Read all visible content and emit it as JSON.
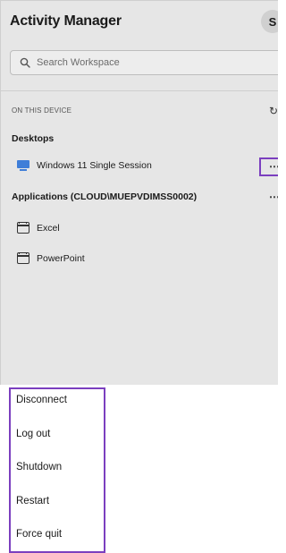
{
  "header": {
    "title": "Activity Manager",
    "avatar_initial": "S"
  },
  "search": {
    "placeholder": "Search Workspace"
  },
  "section": {
    "label": "ON THIS DEVICE"
  },
  "desktops": {
    "heading": "Desktops",
    "items": [
      {
        "label": "Windows 11 Single Session",
        "icon": "monitor-icon"
      }
    ]
  },
  "applications": {
    "heading": "Applications (CLOUD\\MUEPVDIMSS0002)",
    "items": [
      {
        "label": "Excel",
        "icon": "app-window-icon"
      },
      {
        "label": "PowerPoint",
        "icon": "app-window-icon"
      }
    ]
  },
  "menu": {
    "items": [
      "Disconnect",
      "Log out",
      "Shutdown",
      "Restart",
      "Force quit"
    ]
  },
  "colors": {
    "highlight": "#7b3fbf",
    "monitor_accent": "#3f7ed8",
    "panel_bg": "#e6e6e6"
  }
}
